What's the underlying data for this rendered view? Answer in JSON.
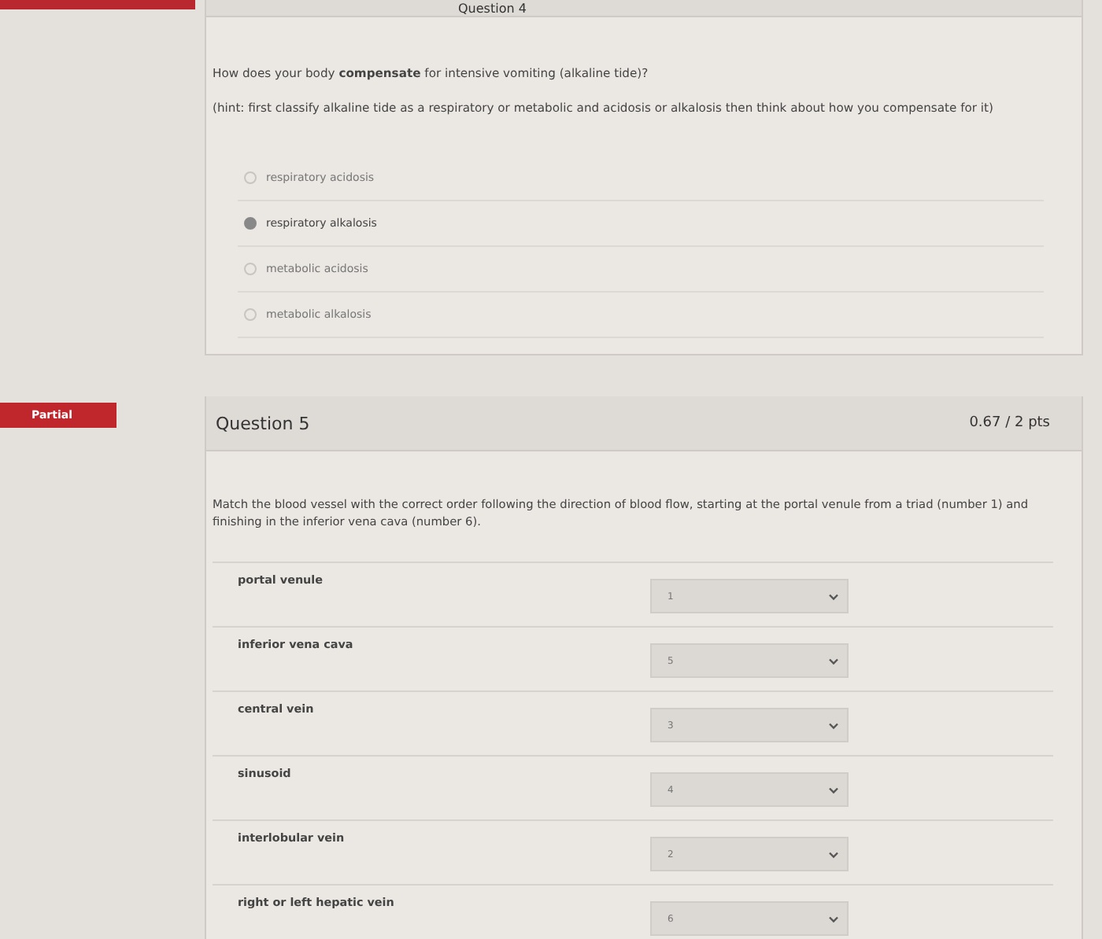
{
  "question_4": {
    "title": "Question 4",
    "prompt": "How does your body **compensate** for intensive vomiting (alkaline tide)?",
    "hint": "(hint: first classify alkaline tide as a respiratory or metabolic and acidosis or alkalosis then think about how you compensate for it)",
    "options": [
      {
        "label": "respiratory acidosis",
        "selected": false
      },
      {
        "label": "respiratory alkalosis",
        "selected": true
      },
      {
        "label": "metabolic acidosis",
        "selected": false
      },
      {
        "label": "metabolic alkalosis",
        "selected": false
      }
    ]
  },
  "question_5": {
    "status": "Partial",
    "title": "Question 5",
    "score": "0.67 / 2 pts",
    "prompt": "Match the blood vessel with the correct order following the direction of blood flow, starting at the portal venule from a triad (number 1) and finishing in the inferior vena cava (number 6).",
    "matches": [
      {
        "term": "portal venule",
        "answer": "1"
      },
      {
        "term": "inferior vena cava",
        "answer": "5"
      },
      {
        "term": "central vein",
        "answer": "3"
      },
      {
        "term": "sinusoid",
        "answer": "4"
      },
      {
        "term": "interlobular vein",
        "answer": "2"
      },
      {
        "term": "right or left hepatic vein",
        "answer": "6"
      }
    ]
  }
}
